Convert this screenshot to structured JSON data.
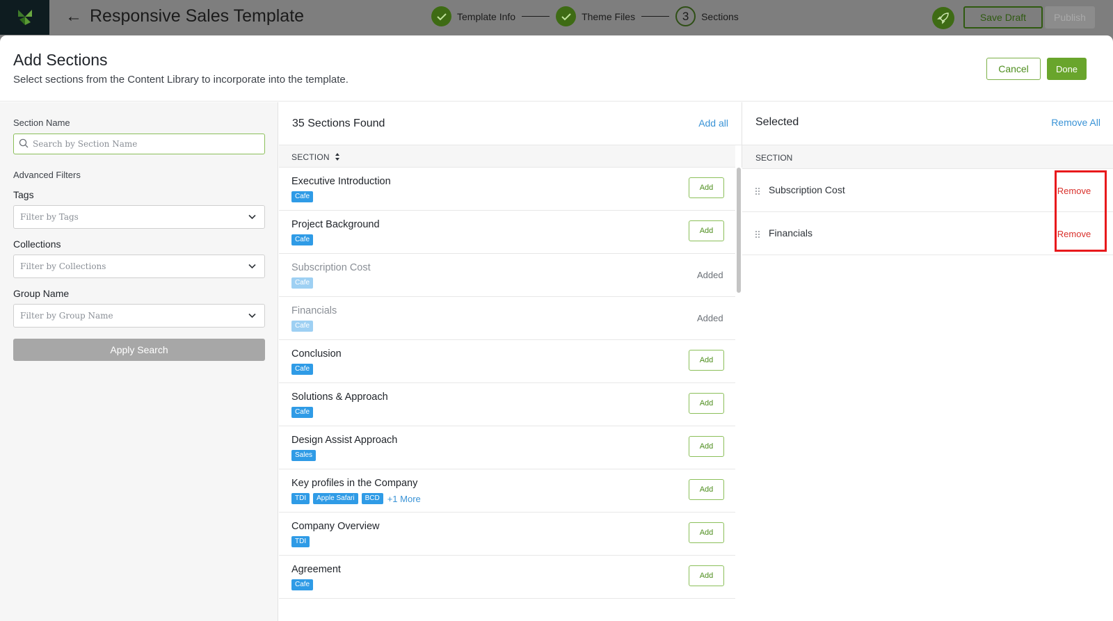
{
  "topbar": {
    "title": "Responsive Sales Template",
    "steps": [
      {
        "label": "Template Info",
        "state": "done"
      },
      {
        "label": "Theme Files",
        "state": "done"
      },
      {
        "label": "Sections",
        "number": "3",
        "state": "current"
      }
    ],
    "save_draft": "Save Draft",
    "publish": "Publish"
  },
  "modal": {
    "title": "Add Sections",
    "subtitle": "Select sections from the Content Library to incorporate into the template.",
    "cancel": "Cancel",
    "done": "Done"
  },
  "filters": {
    "section_name_label": "Section Name",
    "search_placeholder": "Search by Section Name",
    "advanced_label": "Advanced Filters",
    "tags_label": "Tags",
    "tags_placeholder": "Filter by Tags",
    "collections_label": "Collections",
    "collections_placeholder": "Filter by Collections",
    "group_label": "Group Name",
    "group_placeholder": "Filter by Group Name",
    "apply": "Apply Search"
  },
  "list": {
    "found": "35 Sections Found",
    "add_all": "Add all",
    "column": "SECTION",
    "add_label": "Add",
    "added_label": "Added",
    "rows": [
      {
        "title": "Executive Introduction",
        "tags": [
          "Cafe"
        ],
        "added": false
      },
      {
        "title": "Project Background",
        "tags": [
          "Cafe"
        ],
        "added": false
      },
      {
        "title": "Subscription Cost",
        "tags": [
          "Cafe"
        ],
        "added": true
      },
      {
        "title": "Financials",
        "tags": [
          "Cafe"
        ],
        "added": true
      },
      {
        "title": "Conclusion",
        "tags": [
          "Cafe"
        ],
        "added": false
      },
      {
        "title": "Solutions & Approach",
        "tags": [
          "Cafe"
        ],
        "added": false
      },
      {
        "title": "Design Assist Approach",
        "tags": [
          "Sales"
        ],
        "added": false
      },
      {
        "title": "Key profiles in the Company",
        "tags": [
          "TDI",
          "Apple Safari",
          "BCD"
        ],
        "more": "+1 More",
        "added": false
      },
      {
        "title": "Company Overview",
        "tags": [
          "TDI"
        ],
        "added": false
      },
      {
        "title": "Agreement",
        "tags": [
          "Cafe"
        ],
        "added": false
      }
    ]
  },
  "selected": {
    "title": "Selected",
    "remove_all": "Remove All",
    "column": "SECTION",
    "remove_label": "Remove",
    "items": [
      "Subscription Cost",
      "Financials"
    ]
  },
  "colors": {
    "accent_green": "#69a52c",
    "link_blue": "#3a93d6",
    "tag_blue": "#2f9be6",
    "remove_red": "#d9302b",
    "highlight_red": "#e8191c"
  }
}
